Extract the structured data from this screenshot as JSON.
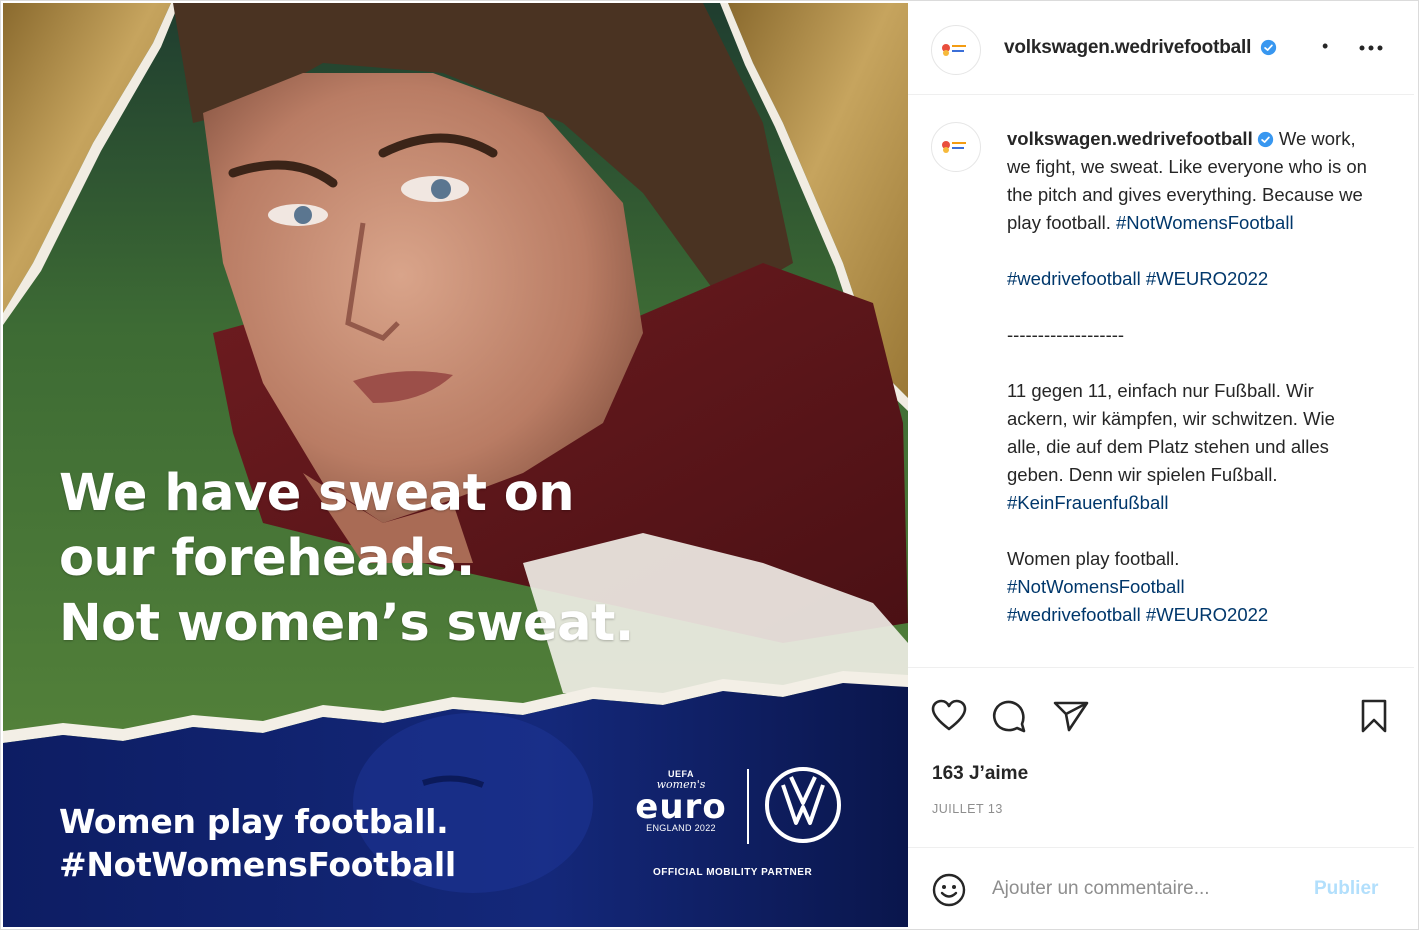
{
  "image": {
    "headline": [
      "We have sweat on",
      "our foreheads.",
      "Not women’s sweat."
    ],
    "tagline": [
      "Women play football.",
      "#NotWomensFootball"
    ],
    "euro_logo": {
      "uefa": "UEFA",
      "womens": "women's",
      "word": "euro",
      "sub": "ENGLAND 2022"
    },
    "partner_text": "OFFICIAL MOBILITY PARTNER",
    "brand_icon": "vw-logo-icon"
  },
  "header": {
    "handle": "volkswagen.wedrivefootball",
    "separator": "•"
  },
  "caption": {
    "handle": "volkswagen.wedrivefootball",
    "text_1": " We work, we fight, we sweat. Like everyone who is on the pitch and gives everything. Because we play football. ",
    "tag_1": "#NotWomensFootball",
    "tag_2": "#wedrivefootball",
    "tag_3": "#WEURO2022",
    "divider": "-------------------",
    "text_de": "11 gegen 11, einfach nur Fußball. Wir ackern, wir kämpfen, wir schwitzen. Wie alle, die auf dem Platz stehen und alles geben. Denn wir spielen Fußball.",
    "tag_de": "#KeinFrauenfußball",
    "text_3": "Women play football.",
    "tag_4": "#NotWomensFootball",
    "tag_5": "#wedrivefootball",
    "tag_6": "#WEURO2022"
  },
  "stats": {
    "likes": "163 J’aime",
    "date": "JUILLET 13"
  },
  "comment": {
    "placeholder": "Ajouter un commentaire...",
    "publish": "Publier"
  },
  "colors": {
    "hashtag": "#00376b",
    "verified": "#3897f0",
    "publish_disabled": "#b2dffc",
    "bottom_band": "#0b1a5a"
  }
}
